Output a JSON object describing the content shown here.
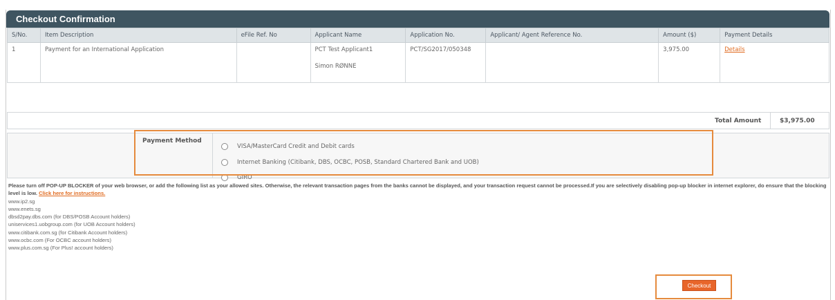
{
  "panel": {
    "title": "Checkout Confirmation"
  },
  "table": {
    "columns": [
      "S/No.",
      "Item Description",
      "eFile Ref. No",
      "Applicant Name",
      "Application No.",
      "Applicant/ Agent Reference No.",
      "Amount ($)",
      "Payment Details"
    ],
    "rows": [
      {
        "sno": "1",
        "description": "Payment for an International Application",
        "efile_ref": "",
        "applicant_1": "PCT Test Applicant1",
        "applicant_2": "Simon RØNNE",
        "application_no": "PCT/SG2017/050348",
        "agent_ref": "",
        "amount": "3,975.00",
        "details_link": "Details"
      }
    ]
  },
  "total": {
    "label": "Total Amount",
    "value": "$3,975.00"
  },
  "payment": {
    "label": "Payment Method",
    "options": [
      "VISA/MasterCard Credit and Debit cards",
      "Internet Banking (Citibank, DBS, OCBC, POSB, Standard Chartered Bank and UOB)",
      "GIRO"
    ]
  },
  "notice": {
    "text": "Please turn off POP-UP BLOCKER of your web browser, or add the following list as your allowed sites. Otherwise, the relevant transaction pages from the banks cannot be displayed, and your transaction request cannot be processed.If you are selectively disabling pop-up blocker in internet explorer, do ensure that the blocking level is low.",
    "link": "Click here for instructions.",
    "sites": [
      "www.ip2.sg",
      "www.enets.sg",
      "dbsd2pay.dbs.com (for DBS/POSB Account holders)",
      "uniservices1.uobgroup.com (for UOB Account holders)",
      "www.citibank.com.sg (for Citibank Account holders)",
      "www.ocbc.com (For OCBC account holders)",
      "www.plus.com.sg (For Plus! account holders)"
    ]
  },
  "actions": {
    "checkout": "Checkout"
  },
  "colors": {
    "header": "#3f5561",
    "accent": "#e8652a",
    "highlight": "#e58a3c"
  }
}
